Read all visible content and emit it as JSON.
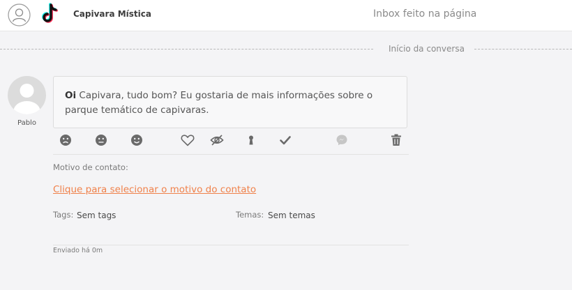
{
  "header": {
    "page_name": "Capivara Mística",
    "source": "Inbox feito na página",
    "icons": [
      "user-circle-icon",
      "tiktok-icon"
    ]
  },
  "conversation": {
    "start_label": "Início da conversa"
  },
  "message": {
    "author": "Pablo",
    "greeting": "Oi",
    "text": " Capivara, tudo bom? Eu gostaria de mais informações sobre o parque temático de capivaras.",
    "actions": [
      "sad-face-icon",
      "neutral-face-icon",
      "happy-face-icon",
      "heart-icon",
      "eye-off-icon",
      "keyhole-icon",
      "check-icon",
      "messenger-icon",
      "trash-icon"
    ]
  },
  "contact": {
    "reason_label": "Motivo de contato:",
    "reason_link": "Clique para selecionar o motivo do contato",
    "tags_label": "Tags:",
    "tags_value": "Sem tags",
    "themes_label": "Temas:",
    "themes_value": "Sem temas",
    "sent": "Enviado há 0m"
  },
  "colors": {
    "accent_link": "#f0814a",
    "icon_gray": "#6a6a6a",
    "background": "#f4f4f6"
  }
}
